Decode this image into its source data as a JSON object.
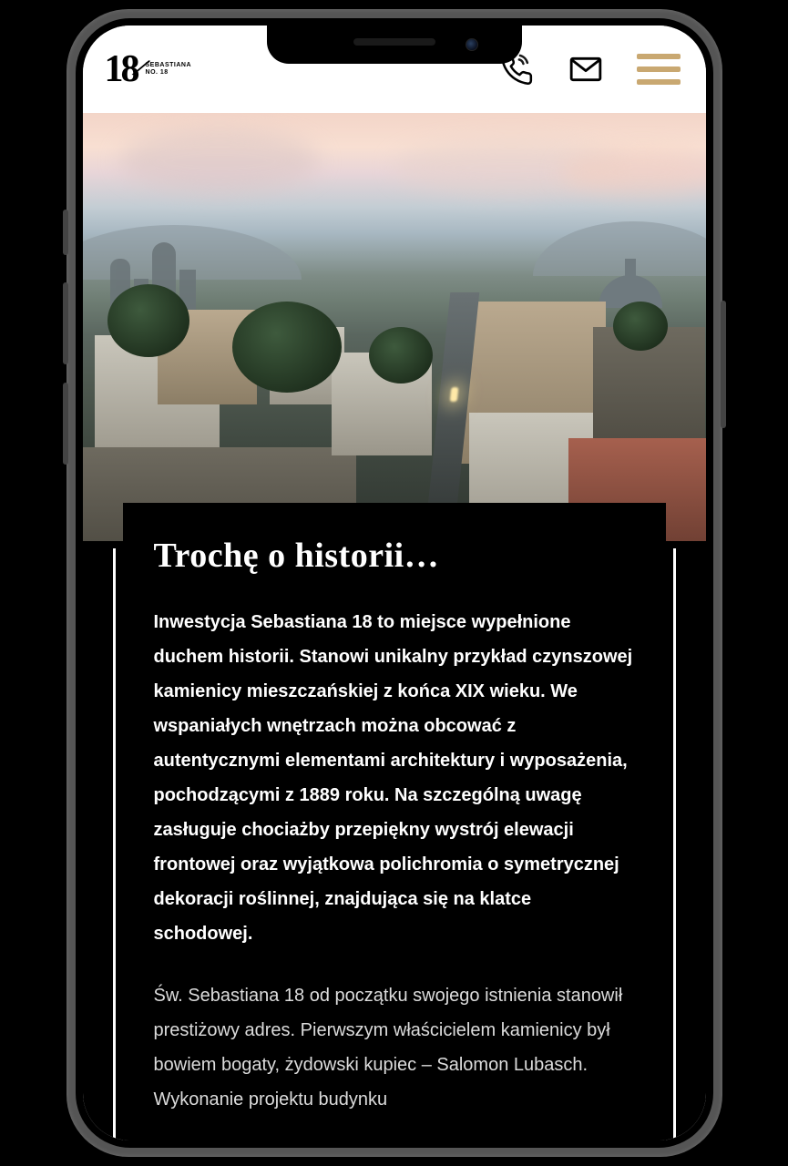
{
  "header": {
    "logo_number": "18",
    "logo_line1": "SEBASTIANA",
    "logo_line2": "NO. 18"
  },
  "content": {
    "title": "Trochę o historii…",
    "paragraph1": "Inwestycja Sebastiana 18 to miejsce wypełnione duchem historii. Stanowi unikalny przykład czynszowej kamienicy mieszczańskiej z końca XIX wieku. We wspaniałych wnętrzach można obcować z autentycznymi elementami architektury i wyposażenia, pochodzącymi z 1889 roku. Na szczególną uwagę zasługuje chociażby przepiękny wystrój elewacji frontowej oraz wyjątkowa polichromia o symetrycznej dekoracji roślinnej, znajdująca się na klatce schodowej.",
    "paragraph2": "Św. Sebastiana 18 od początku swojego istnienia stanowił prestiżowy adres. Pierwszym właścicielem kamienicy był bowiem bogaty, żydowski kupiec – Salomon Lubasch. Wykonanie projektu budynku"
  },
  "colors": {
    "accent": "#C9A871"
  }
}
